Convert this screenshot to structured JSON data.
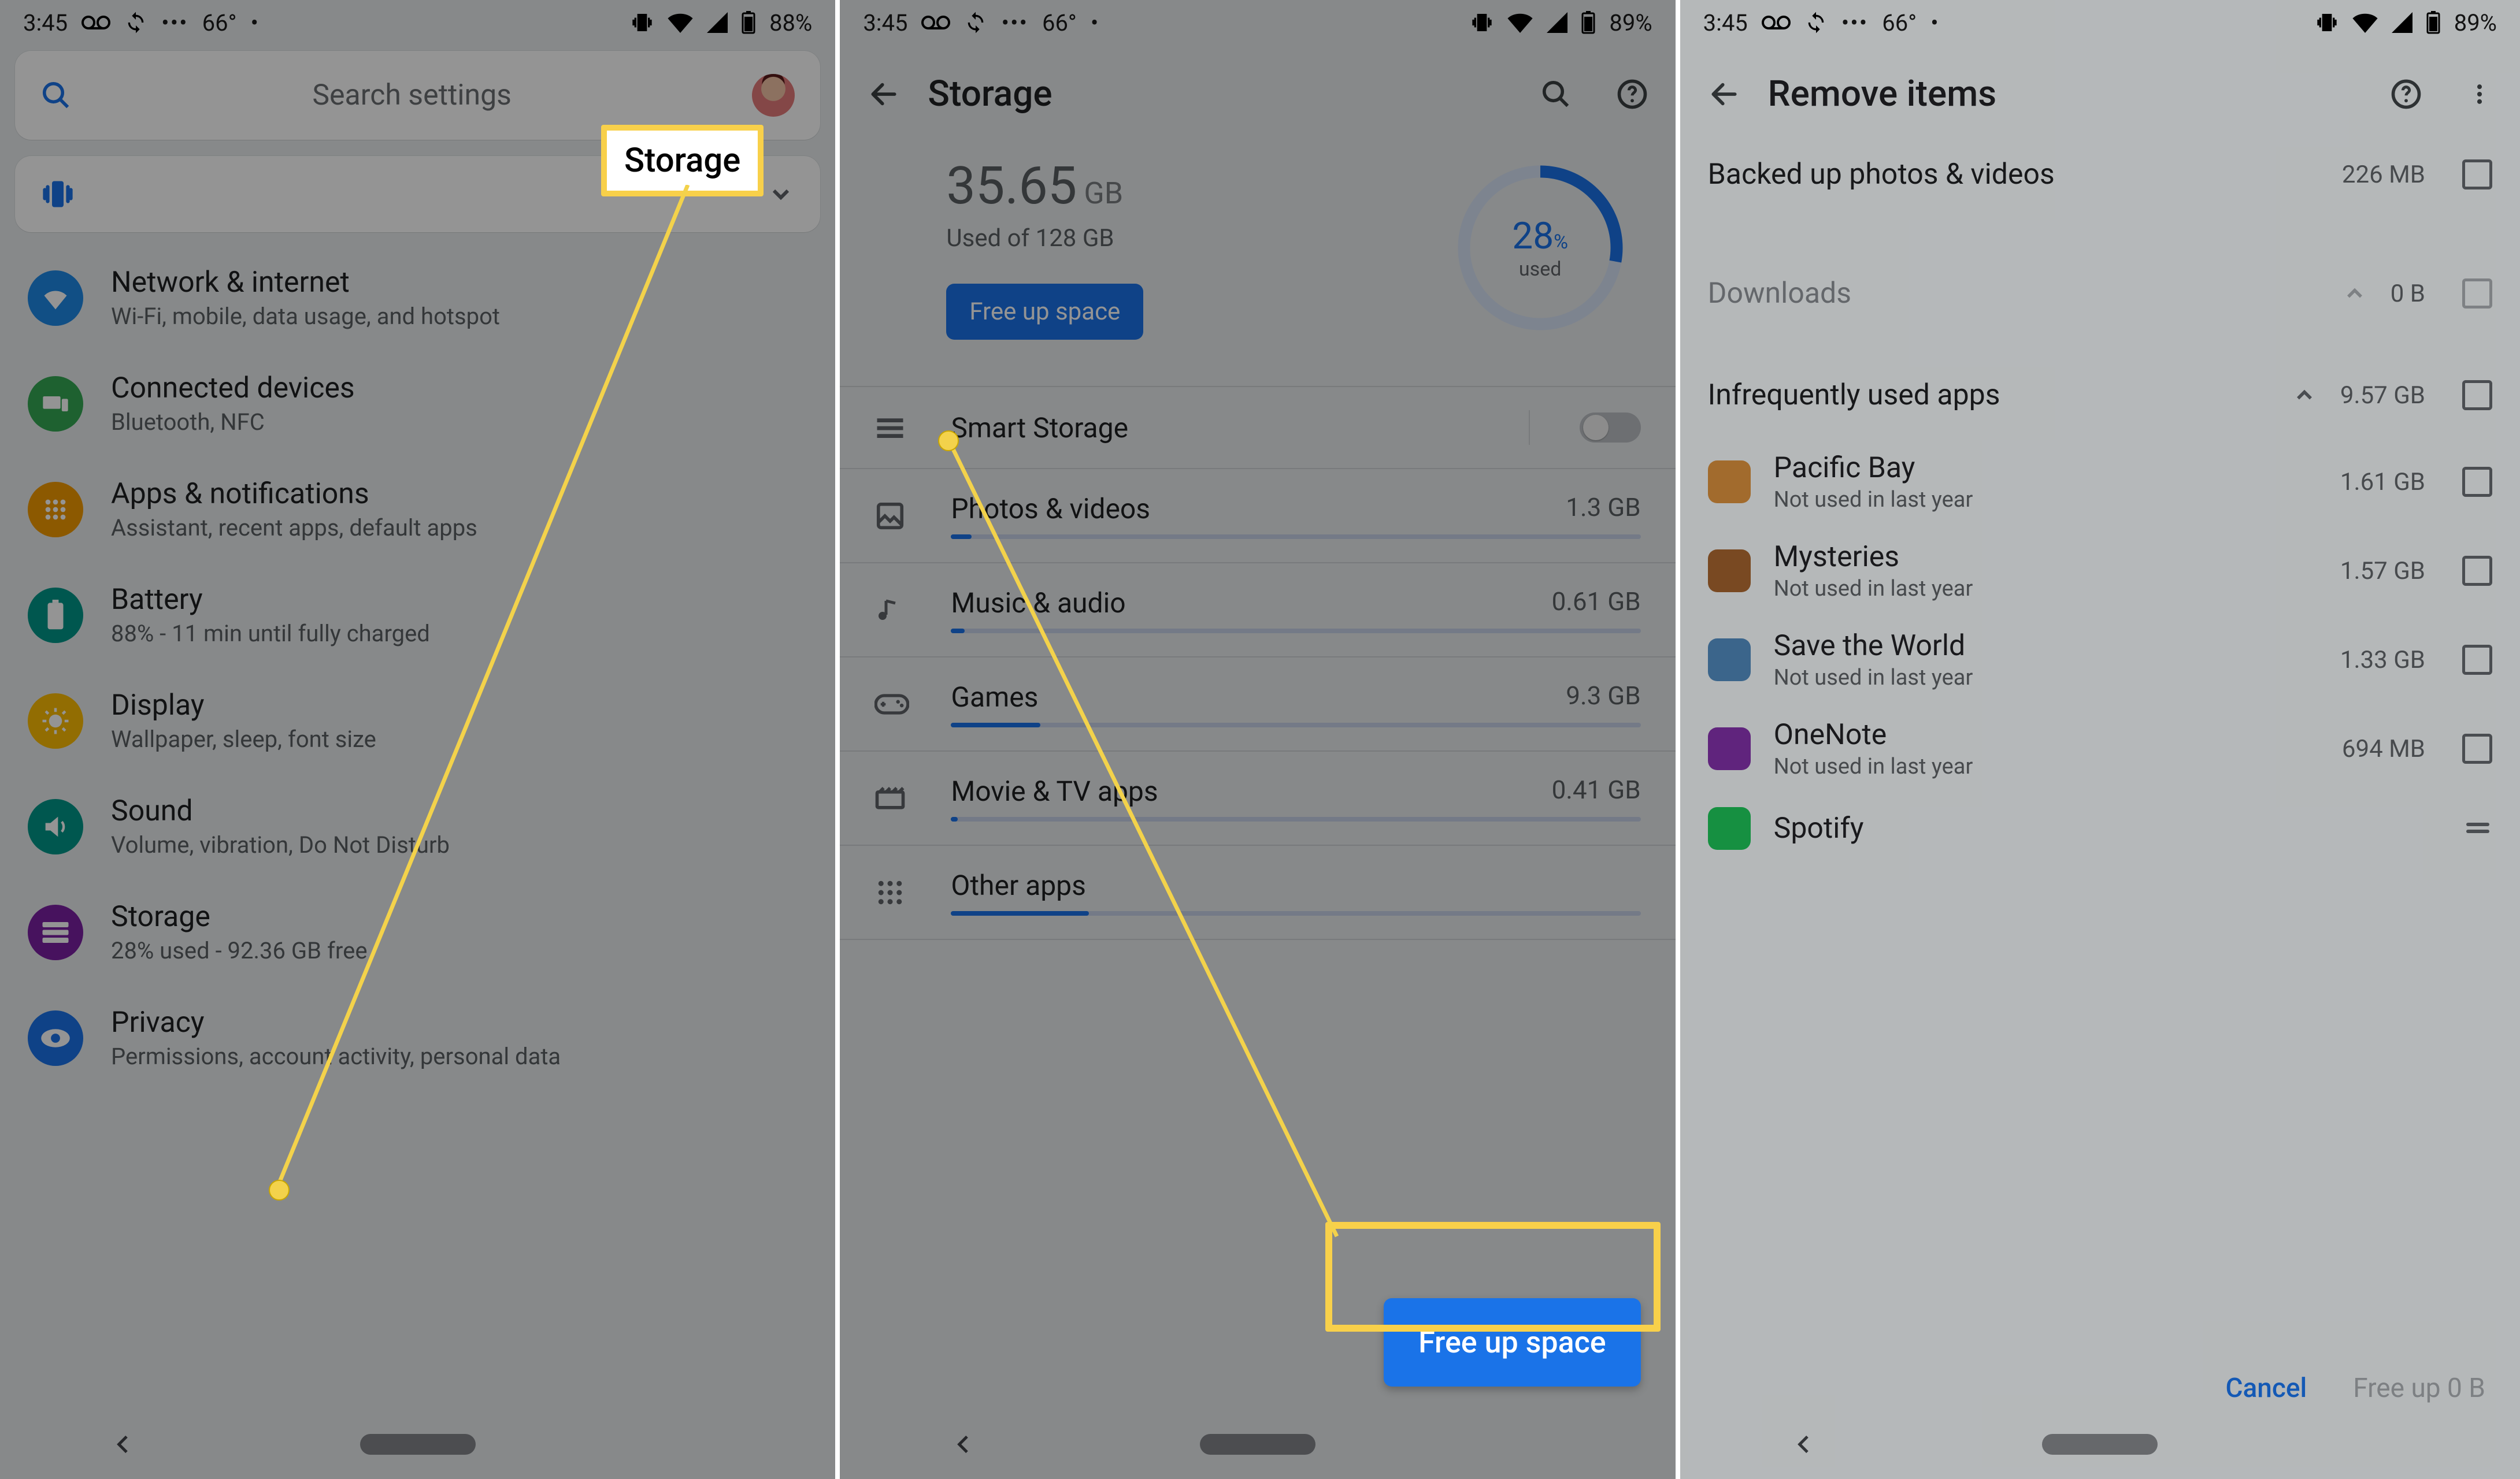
{
  "colors": {
    "accent": "#1a73e8",
    "highlight": "#f8d04a"
  },
  "status": {
    "time": "3:45",
    "temp": "66°",
    "dots": "•••",
    "dot": "•",
    "p1_batt": "88%",
    "p2_batt": "89%",
    "p3_batt": "89%"
  },
  "phone1": {
    "search_placeholder": "Search settings",
    "callout": "Storage",
    "items": [
      {
        "title": "Network & internet",
        "sub": "Wi-Fi, mobile, data usage, and hotspot",
        "color": "c-blue",
        "icon": "wifi"
      },
      {
        "title": "Connected devices",
        "sub": "Bluetooth, NFC",
        "color": "c-green",
        "icon": "devices"
      },
      {
        "title": "Apps & notifications",
        "sub": "Assistant, recent apps, default apps",
        "color": "c-orange",
        "icon": "apps"
      },
      {
        "title": "Battery",
        "sub": "88% - 11 min until fully charged",
        "color": "c-teal",
        "icon": "battery"
      },
      {
        "title": "Display",
        "sub": "Wallpaper, sleep, font size",
        "color": "c-amber",
        "icon": "display"
      },
      {
        "title": "Sound",
        "sub": "Volume, vibration, Do Not Disturb",
        "color": "c-teal",
        "icon": "sound"
      },
      {
        "title": "Storage",
        "sub": "28% used - 92.36 GB free",
        "color": "c-purple",
        "icon": "storage"
      },
      {
        "title": "Privacy",
        "sub": "Permissions, account activity, personal data",
        "color": "c-sky",
        "icon": "privacy"
      }
    ]
  },
  "phone2": {
    "title": "Storage",
    "used_num": "35.65",
    "used_unit": "GB",
    "used_of": "Used of 128 GB",
    "free_btn": "Free up space",
    "percent": "28",
    "percent_symbol": "%",
    "percent_label": "used",
    "fab": "Free up space",
    "cats": [
      {
        "title": "Smart Storage",
        "size": "",
        "icon": "smart",
        "switch": true
      },
      {
        "title": "Photos & videos",
        "size": "1.3 GB",
        "icon": "photos",
        "pct": 3
      },
      {
        "title": "Music & audio",
        "size": "0.61 GB",
        "icon": "music",
        "pct": 2
      },
      {
        "title": "Games",
        "size": "9.3 GB",
        "icon": "games",
        "pct": 13
      },
      {
        "title": "Movie & TV apps",
        "size": "0.41 GB",
        "icon": "movie",
        "pct": 1
      },
      {
        "title": "Other apps",
        "size": "",
        "icon": "other",
        "pct": 20
      }
    ]
  },
  "phone3": {
    "title": "Remove items",
    "groups": [
      {
        "label": "Backed up photos & videos",
        "size": "226 MB",
        "chev": false
      },
      {
        "label": "Downloads",
        "size": "0 B",
        "chev": true,
        "dim": true
      },
      {
        "label": "Infrequently used apps",
        "size": "9.57 GB",
        "chev": true
      }
    ],
    "apps": [
      {
        "name": "Pacific Bay",
        "sub": "Not used in last year",
        "size": "1.61 GB",
        "bg": "#d08a3a"
      },
      {
        "name": "Mysteries",
        "sub": "Not used in last year",
        "size": "1.57 GB",
        "bg": "#9c5e2c"
      },
      {
        "name": "Save the World",
        "sub": "Not used in last year",
        "size": "1.33 GB",
        "bg": "#4c82b3"
      },
      {
        "name": "OneNote",
        "sub": "Not used in last year",
        "size": "694 MB",
        "bg": "#7b2fa0"
      },
      {
        "name": "Spotify",
        "sub": "",
        "size": "",
        "bg": "#1db954"
      }
    ],
    "cancel": "Cancel",
    "free": "Free up 0 B"
  }
}
